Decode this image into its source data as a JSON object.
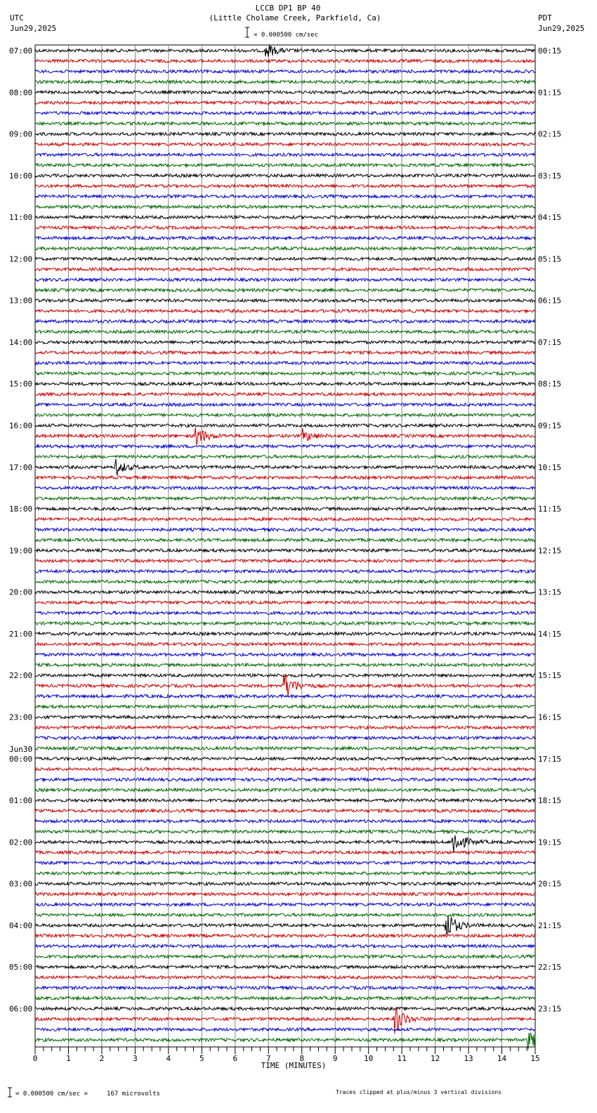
{
  "header": {
    "title": "LCCB DP1 BP 40",
    "subtitle": "(Little Cholame Creek, Parkfield, Ca)",
    "left_tz": "UTC",
    "left_date": "Jun29,2025",
    "right_tz": "PDT",
    "right_date": "Jun29,2025",
    "scale": "= 0.000500 cm/sec"
  },
  "footer": {
    "scale": "= 0.000500 cm/sec =     167 microvolts",
    "clip_note": "Traces clipped at plus/minus 3 vertical divisions"
  },
  "chart_data": {
    "type": "line",
    "title": "LCCB DP1 BP 40",
    "xlabel": "TIME (MINUTES)",
    "xlim": [
      0,
      15
    ],
    "x_ticks": [
      "0",
      "1",
      "2",
      "3",
      "4",
      "5",
      "6",
      "7",
      "8",
      "9",
      "10",
      "11",
      "12",
      "13",
      "14",
      "15"
    ],
    "traces_per_hour": 4,
    "trace_count": 96,
    "trace_colors": [
      "#000000",
      "#cc0000",
      "#0000cc",
      "#006600"
    ],
    "left_labels": [
      "07:00",
      "08:00",
      "09:00",
      "10:00",
      "11:00",
      "12:00",
      "13:00",
      "14:00",
      "15:00",
      "16:00",
      "17:00",
      "18:00",
      "19:00",
      "20:00",
      "21:00",
      "22:00",
      "23:00",
      "00:00",
      "01:00",
      "02:00",
      "03:00",
      "04:00",
      "05:00",
      "06:00"
    ],
    "date_change": {
      "hour_index": 17,
      "label": "Jun30"
    },
    "right_labels": [
      "00:15",
      "01:15",
      "02:15",
      "03:15",
      "04:15",
      "05:15",
      "06:15",
      "07:15",
      "08:15",
      "09:15",
      "10:15",
      "11:15",
      "12:15",
      "13:15",
      "14:15",
      "15:15",
      "16:15",
      "17:15",
      "18:15",
      "19:15",
      "20:15",
      "21:15",
      "22:15",
      "23:15"
    ],
    "events": [
      {
        "trace": 0,
        "minute": 6.9,
        "amp": 1.5
      },
      {
        "trace": 37,
        "minute": 4.8,
        "amp": 2
      },
      {
        "trace": 37,
        "minute": 8.0,
        "amp": 1.3
      },
      {
        "trace": 40,
        "minute": 2.4,
        "amp": 1.5
      },
      {
        "trace": 61,
        "minute": 7.45,
        "amp": 3
      },
      {
        "trace": 76,
        "minute": 12.5,
        "amp": 3
      },
      {
        "trace": 84,
        "minute": 12.3,
        "amp": 3
      },
      {
        "trace": 93,
        "minute": 10.75,
        "amp": 3
      },
      {
        "trace": 95,
        "minute": 14.75,
        "amp": 2
      }
    ]
  }
}
